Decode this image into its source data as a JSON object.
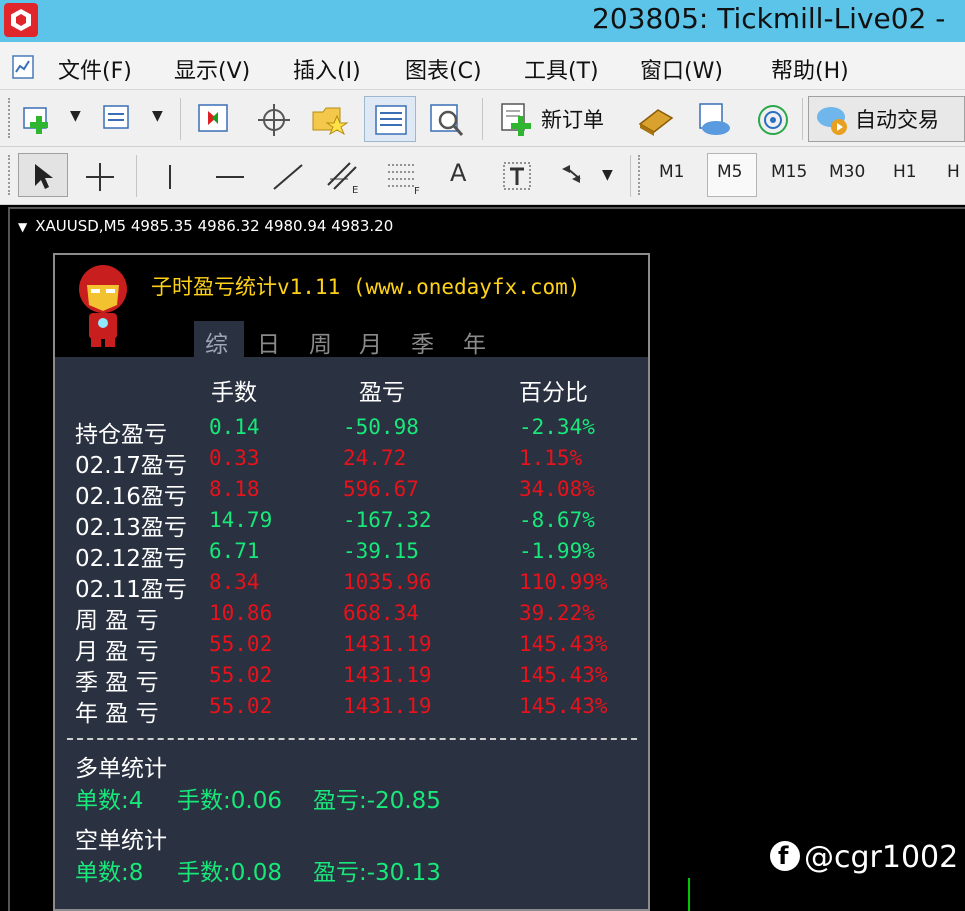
{
  "window": {
    "title": "203805: Tickmill-Live02 -"
  },
  "menu": {
    "items": [
      "文件(F)",
      "显示(V)",
      "插入(I)",
      "图表(C)",
      "工具(T)",
      "窗口(W)",
      "帮助(H)"
    ]
  },
  "toolbar": {
    "new_order": "新订单",
    "auto_trade": "自动交易",
    "text_tool": "A",
    "timeframes": [
      "M1",
      "M5",
      "M15",
      "M30",
      "H1",
      "H"
    ],
    "active_timeframe": "M5"
  },
  "chart": {
    "header": "XAUUSD,M5  4985.35 4986.32 4980.94 4983.20"
  },
  "panel": {
    "title": "子时盈亏统计v1.11 (www.onedayfx.com)",
    "tabs": [
      "综",
      "日",
      "周",
      "月",
      "季",
      "年"
    ],
    "active_tab": "综",
    "columns": [
      "手数",
      "盈亏",
      "百分比"
    ],
    "rows": [
      {
        "label": "持仓盈亏",
        "lots": "0.14",
        "pnl": "-50.98",
        "pct": "-2.34%",
        "sign": "neg"
      },
      {
        "label": "02.17盈亏",
        "lots": "0.33",
        "pnl": "24.72",
        "pct": "1.15%",
        "sign": "pos"
      },
      {
        "label": "02.16盈亏",
        "lots": "8.18",
        "pnl": "596.67",
        "pct": "34.08%",
        "sign": "pos"
      },
      {
        "label": "02.13盈亏",
        "lots": "14.79",
        "pnl": "-167.32",
        "pct": "-8.67%",
        "sign": "neg"
      },
      {
        "label": "02.12盈亏",
        "lots": "6.71",
        "pnl": "-39.15",
        "pct": "-1.99%",
        "sign": "neg"
      },
      {
        "label": "02.11盈亏",
        "lots": "8.34",
        "pnl": "1035.96",
        "pct": "110.99%",
        "sign": "pos"
      },
      {
        "label": "周 盈 亏",
        "lots": "10.86",
        "pnl": "668.34",
        "pct": "39.22%",
        "sign": "pos"
      },
      {
        "label": "月 盈 亏",
        "lots": "55.02",
        "pnl": "1431.19",
        "pct": "145.43%",
        "sign": "pos"
      },
      {
        "label": "季 盈 亏",
        "lots": "55.02",
        "pnl": "1431.19",
        "pct": "145.43%",
        "sign": "pos"
      },
      {
        "label": "年 盈 亏",
        "lots": "55.02",
        "pnl": "1431.19",
        "pct": "145.43%",
        "sign": "pos"
      }
    ],
    "long": {
      "title": "多单统计",
      "count": "单数:4",
      "lots": "手数:0.06",
      "pnl": "盈亏:-20.85"
    },
    "short": {
      "title": "空单统计",
      "count": "单数:8",
      "lots": "手数:0.08",
      "pnl": "盈亏:-30.13"
    },
    "colors": {
      "profit": "#e8121b",
      "loss": "#18e87a"
    }
  },
  "watermark": {
    "text": "@cgr1002",
    "icon": "f-logo-icon"
  }
}
